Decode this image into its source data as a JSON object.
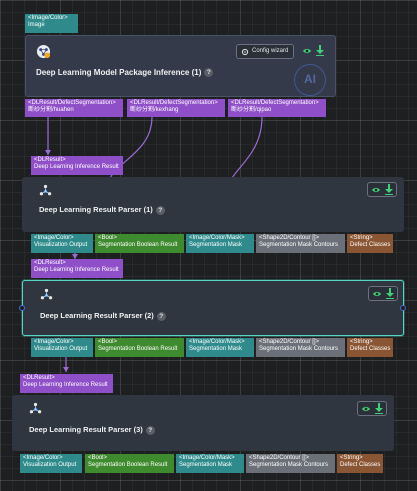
{
  "nodes": {
    "model_package": {
      "title": "Deep Learning Model Package Inference (1)",
      "help": "?",
      "input": {
        "type": "<Image/Color>",
        "label": "Image"
      },
      "config_button": "Config wizard",
      "outputs": [
        {
          "type": "<DLResult/DefectSegmentation>",
          "label": "断纱分割/huahen"
        },
        {
          "type": "<DLResult/DefectSegmentation>",
          "label": "断纱分割/kexhang"
        },
        {
          "type": "<DLResult/DefectSegmentation>",
          "label": "断纱分割/qipao"
        }
      ],
      "badge": "AI"
    },
    "parser1": {
      "title": "Deep Learning Result Parser (1)",
      "help": "?",
      "input": {
        "type": "<DLResult>",
        "label": "Deep Learning Inference Result"
      },
      "outputs": [
        {
          "type": "<Image/Color>",
          "label": "Visualization Output"
        },
        {
          "type": "<Bool>",
          "label": "Segmentation Boolean Result"
        },
        {
          "type": "<Image/Color/Mask>",
          "label": "Segmentation Mask"
        },
        {
          "type": "<Shape2D/Contour []>",
          "label": "Segmentation Mask Contours"
        },
        {
          "type": "<String>",
          "label": "Defect Classes"
        }
      ]
    },
    "parser2": {
      "title": "Deep Learning Result Parser (2)",
      "help": "?",
      "input": {
        "type": "<DLResult>",
        "label": "Deep Learning Inference Result"
      },
      "outputs": [
        {
          "type": "<Image/Color>",
          "label": "Visualization Output"
        },
        {
          "type": "<Bool>",
          "label": "Segmentation Boolean Result"
        },
        {
          "type": "<Image/Color/Mask>",
          "label": "Segmentation Mask"
        },
        {
          "type": "<Shape2D/Contour []>",
          "label": "Segmentation Mask Contours"
        },
        {
          "type": "<String>",
          "label": "Defect Classes"
        }
      ]
    },
    "parser3": {
      "title": "Deep Learning Result Parser (3)",
      "help": "?",
      "input": {
        "type": "<DLResult>",
        "label": "Deep Learning Inference Result"
      },
      "outputs": [
        {
          "type": "<Image/Color>",
          "label": "Visualization Output"
        },
        {
          "type": "<Bool>",
          "label": "Segmentation Boolean Result"
        },
        {
          "type": "<Image/Color/Mask>",
          "label": "Segmentation Mask"
        },
        {
          "type": "<Shape2D/Contour []>",
          "label": "Segmentation Mask Contours"
        },
        {
          "type": "<String>",
          "label": "Defect Classes"
        }
      ]
    }
  },
  "icons": {
    "node_icon": "neural-network-icon",
    "preview": "eye-icon",
    "run": "download-arrow-icon"
  },
  "colors": {
    "image_port": "#2f8b8b",
    "dlresult_port": "#8f4fc8",
    "bool_port": "#3e8a2e",
    "shape_port": "#6b6f78",
    "string_port": "#8a5533",
    "selection": "#55d6c5",
    "action_green": "#3fd07a"
  }
}
